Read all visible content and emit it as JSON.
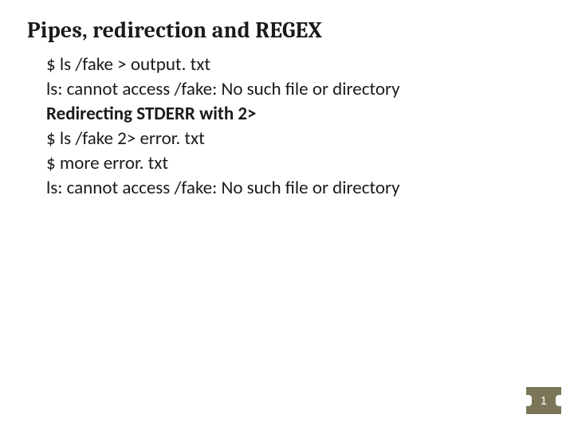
{
  "title": "Pipes, redirection and REGEX",
  "lines": [
    {
      "text": "$ ls /fake > output. txt",
      "bold": false
    },
    {
      "text": "ls: cannot access /fake: No such file or directory",
      "bold": false
    },
    {
      "text": "Redirecting STDERR with 2>",
      "bold": true
    },
    {
      "text": "$ ls /fake 2> error. txt",
      "bold": false
    },
    {
      "text": "$ more error. txt",
      "bold": false
    },
    {
      "text": "ls: cannot access /fake: No such file or directory",
      "bold": false
    }
  ],
  "page_number": "1"
}
